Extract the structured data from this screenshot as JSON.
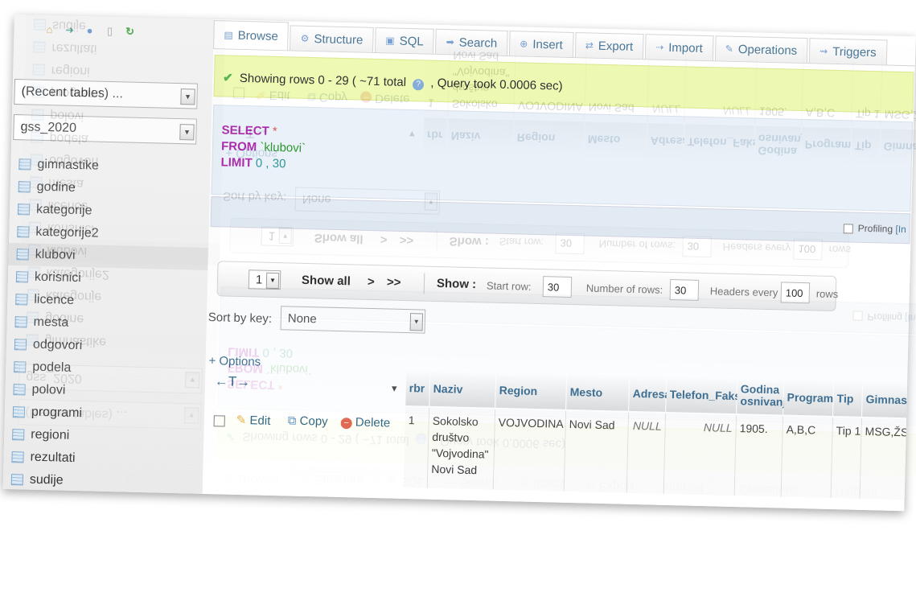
{
  "sidebar": {
    "icons": [
      "home-icon",
      "exit-icon",
      "info-icon",
      "doc-icon",
      "reload-icon"
    ],
    "recent_tables": "(Recent tables) ...",
    "database": "gss_2020",
    "tables": [
      "gimnastike",
      "godine",
      "kategorije",
      "kategorije2",
      "klubovi",
      "korisnici",
      "licence",
      "mesta",
      "odgovori",
      "podela",
      "polovi",
      "programi",
      "regioni",
      "rezultati",
      "sudije"
    ],
    "active_table": "klubovi"
  },
  "tabs": [
    "Browse",
    "Structure",
    "SQL",
    "Search",
    "Insert",
    "Export",
    "Import",
    "Operations",
    "Triggers"
  ],
  "message": {
    "text_prefix": "Showing rows 0 - 29 ( ~71 total",
    "text_suffix": ", Query took 0.0006 sec)"
  },
  "sql": {
    "select": "SELECT",
    "star": "*",
    "from": "FROM",
    "table": "`klubovi`",
    "limit": "LIMIT",
    "limit_vals": "0 , 30"
  },
  "profiling": {
    "label": "Profiling",
    "link": "[In"
  },
  "navigation": {
    "page": "1",
    "show_all": "Show all",
    "next": ">",
    "last": ">>",
    "show_label": "Show :",
    "start_row_label": "Start row:",
    "start_row": "30",
    "num_rows_label": "Number of rows:",
    "num_rows": "30",
    "headers_every_label": "Headers every",
    "headers_every": "100",
    "rows_label": "rows"
  },
  "sort": {
    "label": "Sort by key:",
    "value": "None"
  },
  "options_link": "+ Options",
  "column_arrows": "←T→",
  "columns": [
    "rbr",
    "Naziv",
    "Region",
    "Mesto",
    "Adresa",
    "Telefon_Faks",
    "Godina osnivanja",
    "Programi",
    "Tip",
    "Gimnastike"
  ],
  "row": {
    "actions": {
      "edit": "Edit",
      "copy": "Copy",
      "delete": "Delete"
    },
    "cells": [
      "1",
      "Sokolsko društvo \"Vojvodina\" Novi Sad",
      "VOJVODINA",
      "Novi Sad",
      "NULL",
      "NULL",
      "1905.",
      "A,B,C",
      "Tip 1",
      "MSG,ŽSG"
    ]
  }
}
